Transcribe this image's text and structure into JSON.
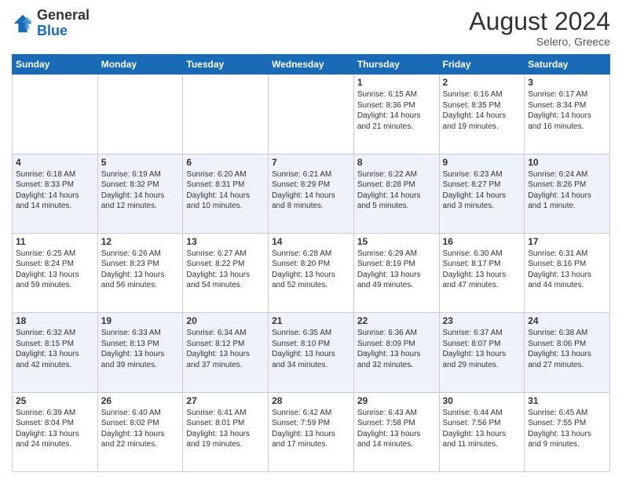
{
  "logo": {
    "line1": "General",
    "line2": "Blue"
  },
  "title": "August 2024",
  "location": "Selero, Greece",
  "days_header": [
    "Sunday",
    "Monday",
    "Tuesday",
    "Wednesday",
    "Thursday",
    "Friday",
    "Saturday"
  ],
  "weeks": [
    [
      {
        "num": "",
        "info": ""
      },
      {
        "num": "",
        "info": ""
      },
      {
        "num": "",
        "info": ""
      },
      {
        "num": "",
        "info": ""
      },
      {
        "num": "1",
        "info": "Sunrise: 6:15 AM\nSunset: 8:36 PM\nDaylight: 14 hours\nand 21 minutes."
      },
      {
        "num": "2",
        "info": "Sunrise: 6:16 AM\nSunset: 8:35 PM\nDaylight: 14 hours\nand 19 minutes."
      },
      {
        "num": "3",
        "info": "Sunrise: 6:17 AM\nSunset: 8:34 PM\nDaylight: 14 hours\nand 16 minutes."
      }
    ],
    [
      {
        "num": "4",
        "info": "Sunrise: 6:18 AM\nSunset: 8:33 PM\nDaylight: 14 hours\nand 14 minutes."
      },
      {
        "num": "5",
        "info": "Sunrise: 6:19 AM\nSunset: 8:32 PM\nDaylight: 14 hours\nand 12 minutes."
      },
      {
        "num": "6",
        "info": "Sunrise: 6:20 AM\nSunset: 8:31 PM\nDaylight: 14 hours\nand 10 minutes."
      },
      {
        "num": "7",
        "info": "Sunrise: 6:21 AM\nSunset: 8:29 PM\nDaylight: 14 hours\nand 8 minutes."
      },
      {
        "num": "8",
        "info": "Sunrise: 6:22 AM\nSunset: 8:28 PM\nDaylight: 14 hours\nand 5 minutes."
      },
      {
        "num": "9",
        "info": "Sunrise: 6:23 AM\nSunset: 8:27 PM\nDaylight: 14 hours\nand 3 minutes."
      },
      {
        "num": "10",
        "info": "Sunrise: 6:24 AM\nSunset: 8:26 PM\nDaylight: 14 hours\nand 1 minute."
      }
    ],
    [
      {
        "num": "11",
        "info": "Sunrise: 6:25 AM\nSunset: 8:24 PM\nDaylight: 13 hours\nand 59 minutes."
      },
      {
        "num": "12",
        "info": "Sunrise: 6:26 AM\nSunset: 8:23 PM\nDaylight: 13 hours\nand 56 minutes."
      },
      {
        "num": "13",
        "info": "Sunrise: 6:27 AM\nSunset: 8:22 PM\nDaylight: 13 hours\nand 54 minutes."
      },
      {
        "num": "14",
        "info": "Sunrise: 6:28 AM\nSunset: 8:20 PM\nDaylight: 13 hours\nand 52 minutes."
      },
      {
        "num": "15",
        "info": "Sunrise: 6:29 AM\nSunset: 8:19 PM\nDaylight: 13 hours\nand 49 minutes."
      },
      {
        "num": "16",
        "info": "Sunrise: 6:30 AM\nSunset: 8:17 PM\nDaylight: 13 hours\nand 47 minutes."
      },
      {
        "num": "17",
        "info": "Sunrise: 6:31 AM\nSunset: 8:16 PM\nDaylight: 13 hours\nand 44 minutes."
      }
    ],
    [
      {
        "num": "18",
        "info": "Sunrise: 6:32 AM\nSunset: 8:15 PM\nDaylight: 13 hours\nand 42 minutes."
      },
      {
        "num": "19",
        "info": "Sunrise: 6:33 AM\nSunset: 8:13 PM\nDaylight: 13 hours\nand 39 minutes."
      },
      {
        "num": "20",
        "info": "Sunrise: 6:34 AM\nSunset: 8:12 PM\nDaylight: 13 hours\nand 37 minutes."
      },
      {
        "num": "21",
        "info": "Sunrise: 6:35 AM\nSunset: 8:10 PM\nDaylight: 13 hours\nand 34 minutes."
      },
      {
        "num": "22",
        "info": "Sunrise: 6:36 AM\nSunset: 8:09 PM\nDaylight: 13 hours\nand 32 minutes."
      },
      {
        "num": "23",
        "info": "Sunrise: 6:37 AM\nSunset: 8:07 PM\nDaylight: 13 hours\nand 29 minutes."
      },
      {
        "num": "24",
        "info": "Sunrise: 6:38 AM\nSunset: 8:06 PM\nDaylight: 13 hours\nand 27 minutes."
      }
    ],
    [
      {
        "num": "25",
        "info": "Sunrise: 6:39 AM\nSunset: 8:04 PM\nDaylight: 13 hours\nand 24 minutes."
      },
      {
        "num": "26",
        "info": "Sunrise: 6:40 AM\nSunset: 8:02 PM\nDaylight: 13 hours\nand 22 minutes."
      },
      {
        "num": "27",
        "info": "Sunrise: 6:41 AM\nSunset: 8:01 PM\nDaylight: 13 hours\nand 19 minutes."
      },
      {
        "num": "28",
        "info": "Sunrise: 6:42 AM\nSunset: 7:59 PM\nDaylight: 13 hours\nand 17 minutes."
      },
      {
        "num": "29",
        "info": "Sunrise: 6:43 AM\nSunset: 7:58 PM\nDaylight: 13 hours\nand 14 minutes."
      },
      {
        "num": "30",
        "info": "Sunrise: 6:44 AM\nSunset: 7:56 PM\nDaylight: 13 hours\nand 11 minutes."
      },
      {
        "num": "31",
        "info": "Sunrise: 6:45 AM\nSunset: 7:55 PM\nDaylight: 13 hours\nand 9 minutes."
      }
    ]
  ]
}
